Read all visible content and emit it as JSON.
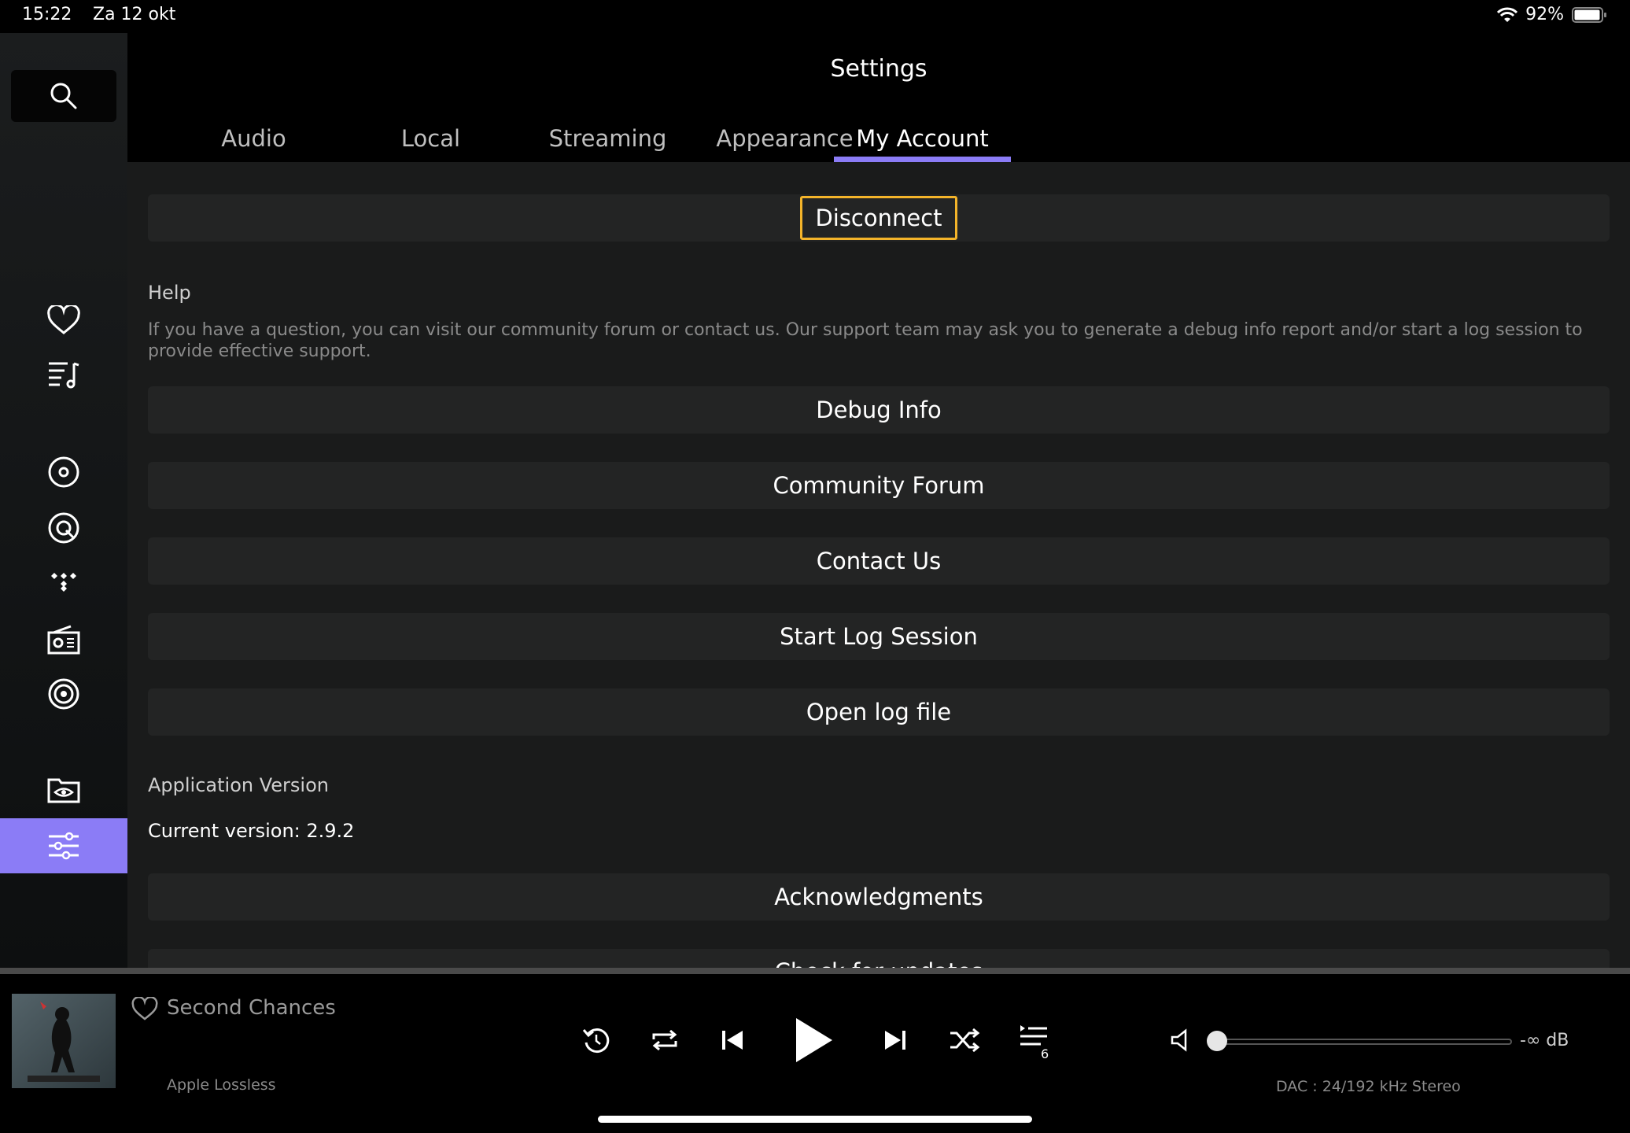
{
  "status": {
    "time": "15:22",
    "date": "Za 12 okt",
    "battery": "92%"
  },
  "header": {
    "title": "Settings"
  },
  "tabs": [
    {
      "label": "Audio"
    },
    {
      "label": "Local"
    },
    {
      "label": "Streaming"
    },
    {
      "label": "Appearance"
    },
    {
      "label": "My Account",
      "active": true
    }
  ],
  "account": {
    "disconnect_label": "Disconnect"
  },
  "help": {
    "title": "Help",
    "description": "If you have a question, you can visit our community forum or contact us. Our support team may ask you to generate a debug info report and/or start a log session to provide effective support.",
    "buttons": [
      "Debug Info",
      "Community Forum",
      "Contact Us",
      "Start Log Session",
      "Open log file"
    ]
  },
  "app_version": {
    "title": "Application Version",
    "current": "Current version: 2.9.2",
    "acknowledgments_label": "Acknowledgments",
    "check_updates_label": "Check for updates"
  },
  "player": {
    "track_title": "Second Chances",
    "format": "Apple Lossless",
    "dac": "DAC : 24/192 kHz Stereo",
    "volume_db": "-∞ dB",
    "queue_count": "6",
    "volume_level": 0
  },
  "colors": {
    "accent": "#8b7cf6",
    "focus": "#f4b42a"
  }
}
